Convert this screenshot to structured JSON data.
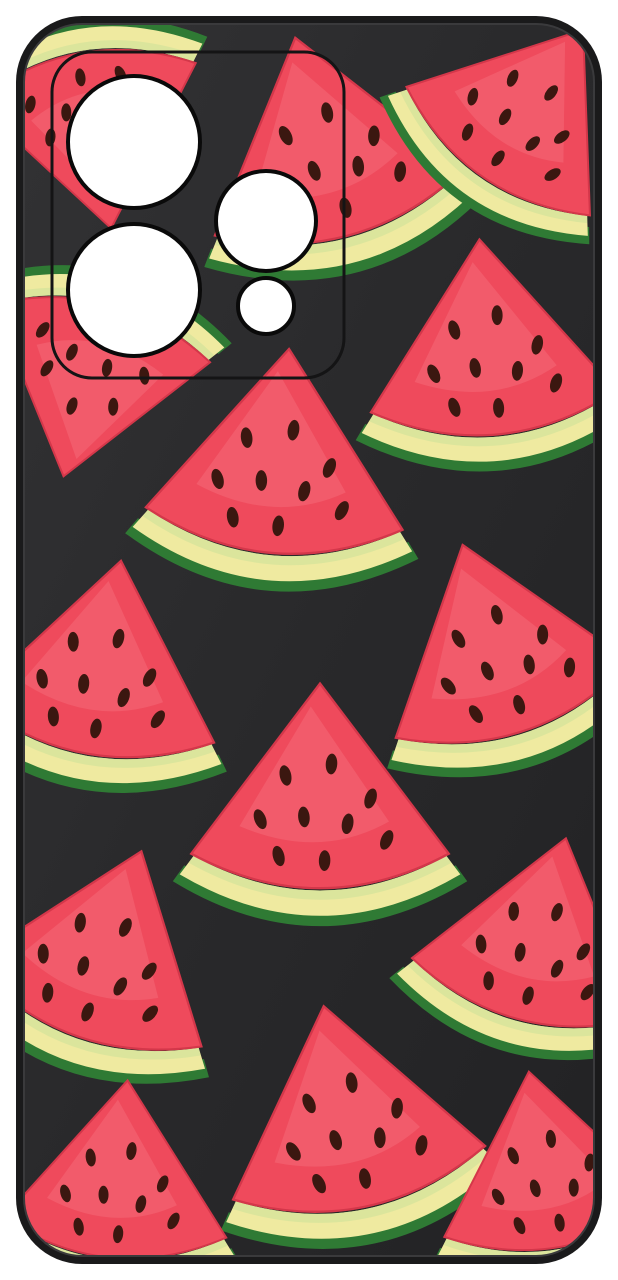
{
  "image": {
    "subject": "phone-case",
    "pattern": "watermark-slice",
    "colors": {
      "page_background": "#ffffff",
      "case_body": "#2b2b2d",
      "case_edge": "#1a1a1b",
      "camera_cutout": "#ffffff",
      "camera_ring": "#0a0a0a",
      "flesh": "#ef4a5c",
      "flesh_light": "#f7707f",
      "flesh_dark": "#d4374a",
      "rind_inner": "#efeaa0",
      "rind_pale": "#d6e39b",
      "rind_outer": "#2f7a34",
      "seed": "#3b1710"
    }
  }
}
